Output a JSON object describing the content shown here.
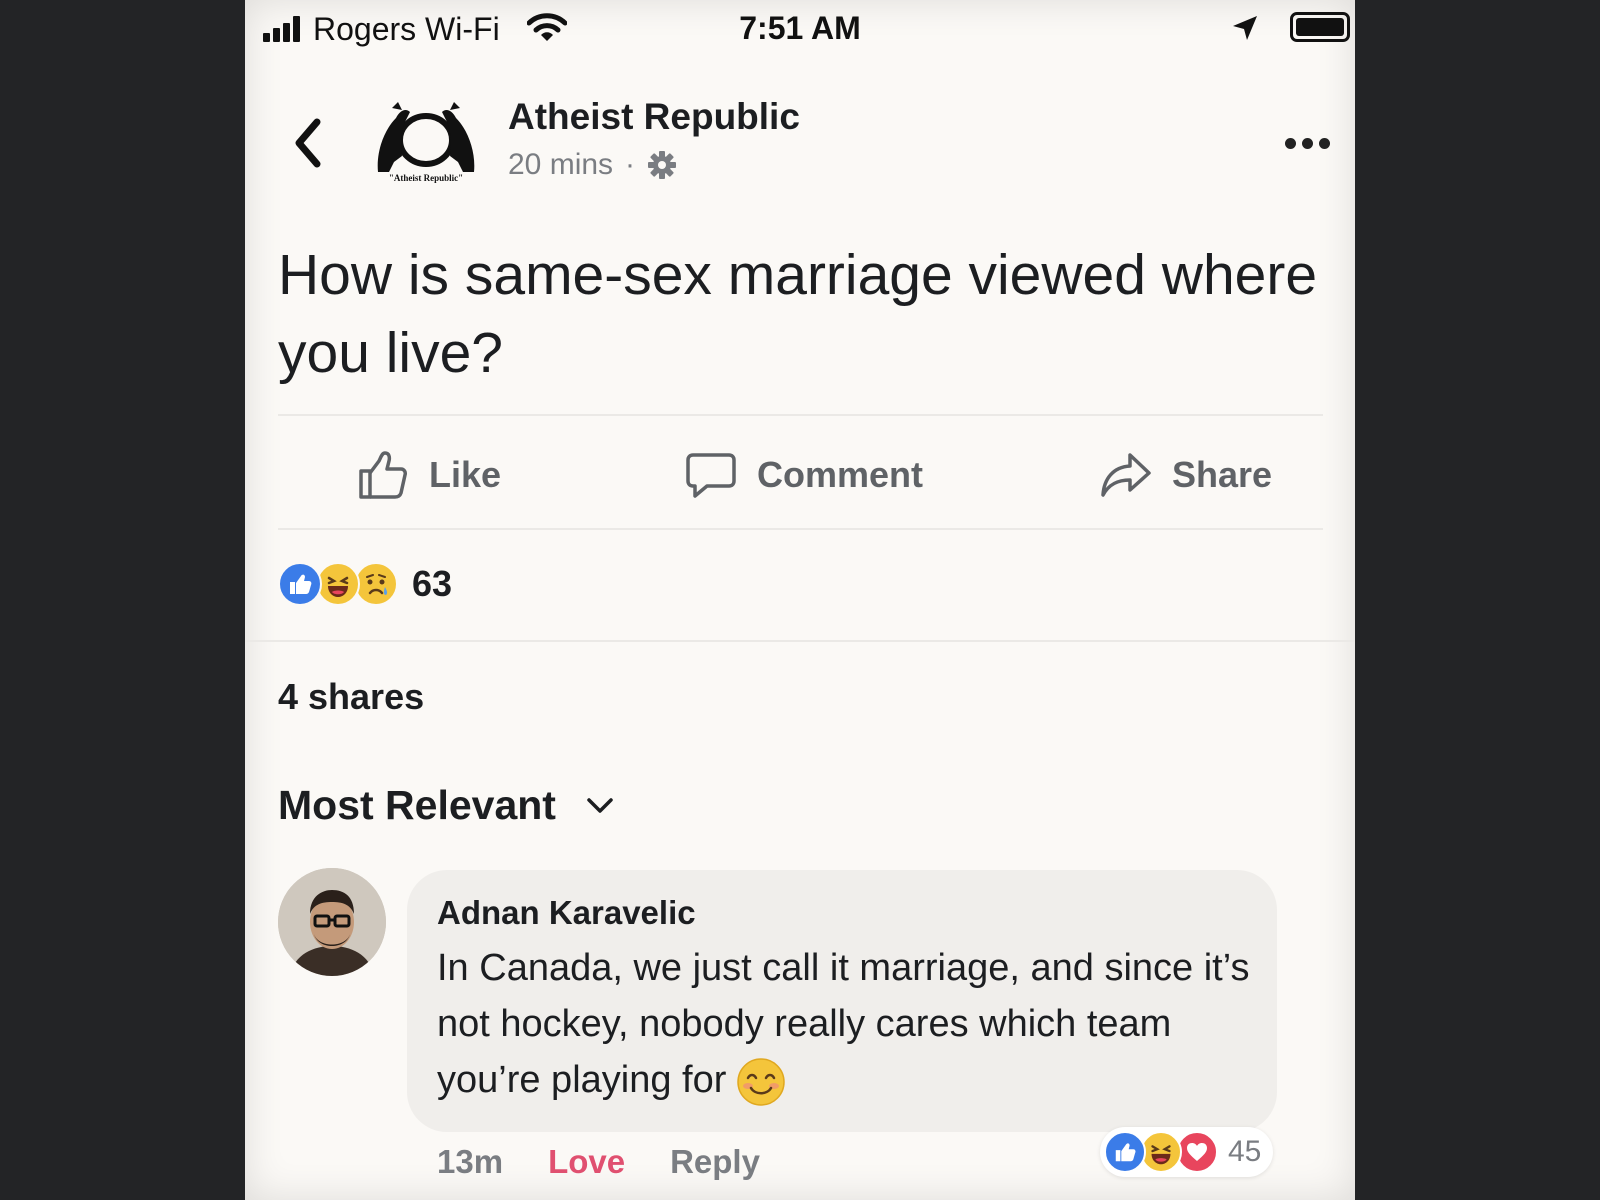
{
  "status_bar": {
    "carrier": "Rogers Wi-Fi",
    "time": "7:51 AM"
  },
  "post": {
    "page_name": "Atheist Republic",
    "logo_text": "Atheist Republic",
    "time_ago": "20 mins",
    "separator": "·",
    "text": "How is same-sex marriage viewed where you live?",
    "actions": {
      "like": "Like",
      "comment": "Comment",
      "share": "Share"
    },
    "reaction_count": "63",
    "reaction_icons": [
      "like-reaction-icon",
      "haha-reaction-icon",
      "sad-reaction-icon"
    ],
    "shares": "4 shares"
  },
  "comments": {
    "sort_label": "Most Relevant",
    "items": [
      {
        "author": "Adnan Karavelic",
        "text": "In Canada, we just call it marriage, and since it’s not hockey, nobody really cares which team you’re playing for",
        "time": "13m",
        "love_label": "Love",
        "reply_label": "Reply",
        "reaction_count": "45",
        "reaction_icons": [
          "like-reaction-icon",
          "haha-reaction-icon",
          "love-reaction-icon"
        ]
      }
    ]
  },
  "colors": {
    "page_bg": "#fbf9f6",
    "outer_bg": "#232426",
    "like_blue": "#3b7ce8",
    "love_red": "#e05070",
    "emoji_yellow": "#f4c53b"
  }
}
